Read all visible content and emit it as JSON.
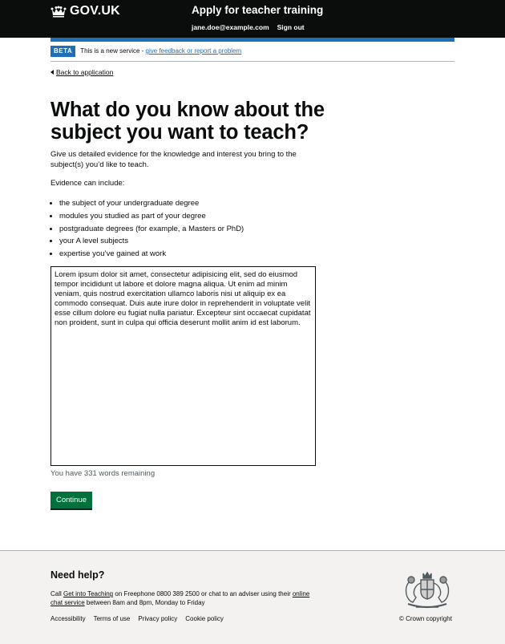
{
  "header": {
    "logo_text": "GOV.UK",
    "service_name": "Apply for teacher training",
    "user_email": "jane.doe@example.com",
    "sign_out": "Sign out"
  },
  "phase_banner": {
    "tag": "BETA",
    "text": "This is a new service - ",
    "link": "give feedback or report a problem"
  },
  "back_link": "Back to application",
  "page": {
    "title": "What do you know about the subject you want to teach?",
    "lead": "Give us detailed evidence for the knowledge and interest you bring to the subject(s) you’d like to teach.",
    "evidence_intro": "Evidence can include:",
    "evidence_items": [
      "the subject of your undergraduate degree",
      "modules you studied as part of your degree",
      "postgraduate degrees (for example, a Masters or PhD)",
      "your A level subjects",
      "expertise you’ve gained at work"
    ],
    "textarea_value": "Lorem ipsum dolor sit amet, consectetur adipisicing elit, sed do eiusmod tempor incididunt ut labore et dolore magna aliqua. Ut enim ad minim veniam, quis nostrud exercitation ullamco laboris nisi ut aliquip ex ea commodo consequat. Duis aute irure dolor in reprehenderit in voluptate velit esse cillum dolore eu fugiat nulla pariatur. Excepteur sint occaecat cupidatat non proident, sunt in culpa qui officia deserunt mollit anim id est laborum.",
    "word_count": "You have 331 words remaining",
    "continue": "Continue"
  },
  "footer": {
    "heading": "Need help?",
    "help_prefix": "Call ",
    "help_link1": "Get into Teaching",
    "help_middle": " on Freephone 0800 389 2500 or chat to an adviser using their ",
    "help_link2": "online chat service",
    "help_suffix": " between 8am and 8pm, Monday to Friday",
    "links": [
      "Accessibility",
      "Terms of use",
      "Privacy policy",
      "Cookie policy"
    ],
    "copyright": "© Crown copyright"
  },
  "colors": {
    "header_bg": "#0b0c0c",
    "brand_blue": "#1d70b8",
    "button_green": "#00703c",
    "footer_bg": "#f3f2f1"
  }
}
